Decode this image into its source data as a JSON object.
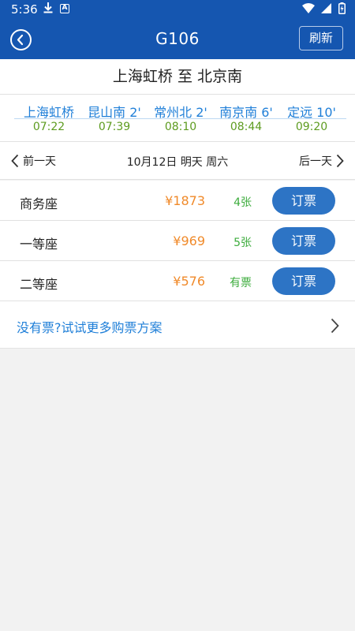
{
  "status_bar": {
    "time": "5:36",
    "icons": [
      "download-icon",
      "notification-a-icon",
      "wifi-icon",
      "signal-icon",
      "battery-icon"
    ]
  },
  "header": {
    "title": "G106",
    "refresh_label": "刷新",
    "back_icon": "back-circle-icon"
  },
  "route": {
    "from": "上海虹桥",
    "connector": "至",
    "to": "北京南"
  },
  "stops": [
    {
      "name": "上海虹桥",
      "time": "07:22"
    },
    {
      "name": "昆山南 2'",
      "time": "07:39"
    },
    {
      "name": "常州北 2'",
      "time": "08:10"
    },
    {
      "name": "南京南 6'",
      "time": "08:44"
    },
    {
      "name": "定远 10'",
      "time": "09:20"
    }
  ],
  "date_bar": {
    "prev_label": "前一天",
    "date": "10月12日",
    "relative_day": "明天",
    "weekday": "周六",
    "next_label": "后一天"
  },
  "seats": [
    {
      "name": "商务座",
      "price": "¥1873",
      "availability": "4张",
      "book_label": "订票"
    },
    {
      "name": "一等座",
      "price": "¥969",
      "availability": "5张",
      "book_label": "订票"
    },
    {
      "name": "二等座",
      "price": "¥576",
      "availability": "有票",
      "book_label": "订票"
    }
  ],
  "more_options": {
    "label": "没有票?试试更多购票方案"
  },
  "colors": {
    "header_blue": "#1556b0",
    "link_blue": "#1f7fd8",
    "time_green": "#5d9b1f",
    "price_orange": "#f08a2a",
    "avail_green": "#3dac3d",
    "button_blue": "#2d74c5"
  }
}
